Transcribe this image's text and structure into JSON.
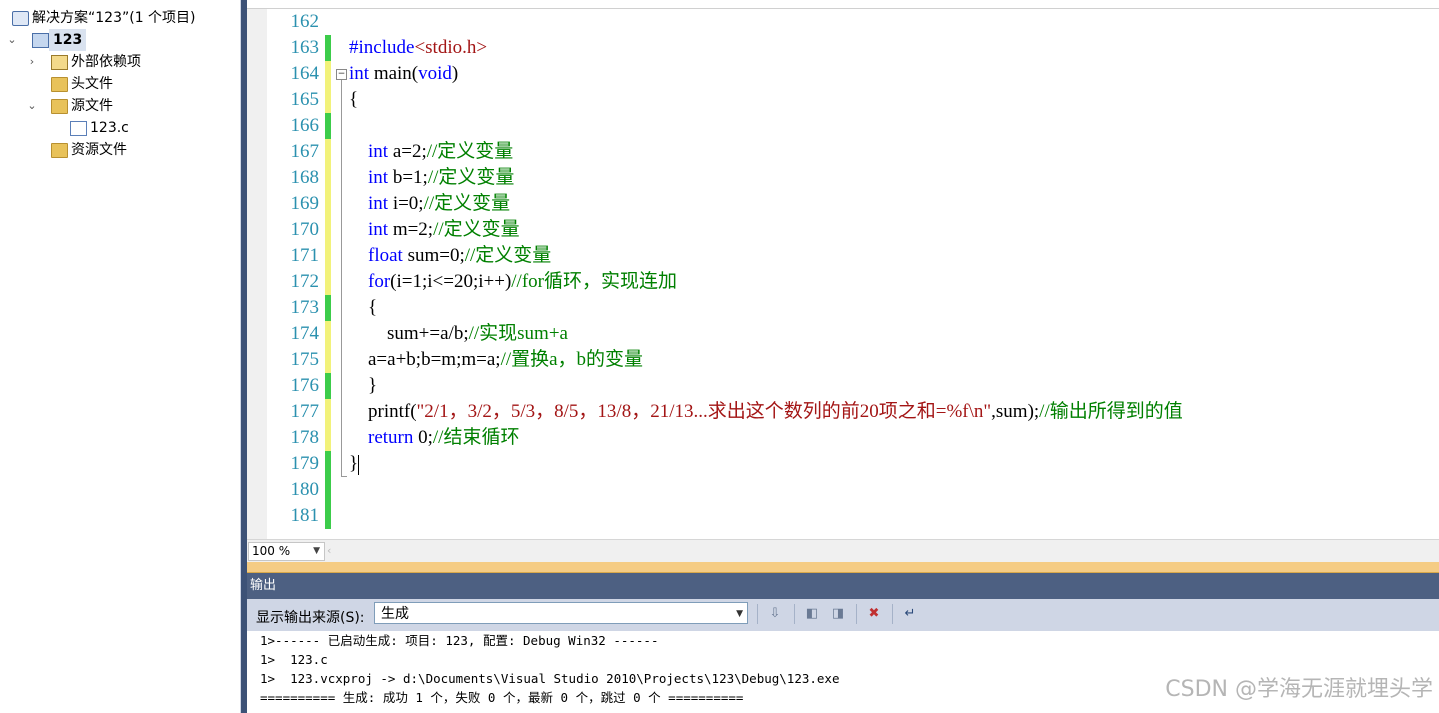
{
  "solution_explorer": {
    "solution_label": "解决方案“123”(1 个项目)",
    "project_label": "123",
    "items": [
      {
        "label": "外部依赖项",
        "icon": "external-deps-icon"
      },
      {
        "label": "头文件",
        "icon": "folder-icon"
      },
      {
        "label": "源文件",
        "icon": "folder-open-icon"
      },
      {
        "label": "123.c",
        "icon": "c-file-icon"
      },
      {
        "label": "资源文件",
        "icon": "folder-icon"
      }
    ]
  },
  "editor": {
    "line_numbers": [
      "162",
      "163",
      "164",
      "165",
      "166",
      "167",
      "168",
      "169",
      "170",
      "171",
      "172",
      "173",
      "174",
      "175",
      "176",
      "177",
      "178",
      "179",
      "180",
      "181"
    ],
    "lines": [
      {
        "segments": []
      },
      {
        "segments": [
          {
            "t": "#include",
            "c": "kw"
          },
          {
            "t": "<stdio.h>",
            "c": "st"
          }
        ]
      },
      {
        "segments": [
          {
            "t": "int",
            "c": "kw"
          },
          {
            "t": " main(",
            "c": ""
          },
          {
            "t": "void",
            "c": "kw"
          },
          {
            "t": ")",
            "c": ""
          }
        ]
      },
      {
        "segments": [
          {
            "t": "{",
            "c": ""
          }
        ]
      },
      {
        "segments": []
      },
      {
        "segments": [
          {
            "t": "    ",
            "c": ""
          },
          {
            "t": "int",
            "c": "kw"
          },
          {
            "t": " a=2;",
            "c": ""
          },
          {
            "t": "//定义变量",
            "c": "cm"
          }
        ]
      },
      {
        "segments": [
          {
            "t": "    ",
            "c": ""
          },
          {
            "t": "int",
            "c": "kw"
          },
          {
            "t": " b=1;",
            "c": ""
          },
          {
            "t": "//定义变量",
            "c": "cm"
          }
        ]
      },
      {
        "segments": [
          {
            "t": "    ",
            "c": ""
          },
          {
            "t": "int",
            "c": "kw"
          },
          {
            "t": " i=0;",
            "c": ""
          },
          {
            "t": "//定义变量",
            "c": "cm"
          }
        ]
      },
      {
        "segments": [
          {
            "t": "    ",
            "c": ""
          },
          {
            "t": "int",
            "c": "kw"
          },
          {
            "t": " m=2;",
            "c": ""
          },
          {
            "t": "//定义变量",
            "c": "cm"
          }
        ]
      },
      {
        "segments": [
          {
            "t": "    ",
            "c": ""
          },
          {
            "t": "float",
            "c": "kw"
          },
          {
            "t": " sum=0;",
            "c": ""
          },
          {
            "t": "//定义变量",
            "c": "cm"
          }
        ]
      },
      {
        "segments": [
          {
            "t": "    ",
            "c": ""
          },
          {
            "t": "for",
            "c": "kw"
          },
          {
            "t": "(i=1;i<=20;i++)",
            "c": ""
          },
          {
            "t": "//for循环，实现连加",
            "c": "cm"
          }
        ]
      },
      {
        "segments": [
          {
            "t": "    {",
            "c": ""
          }
        ]
      },
      {
        "segments": [
          {
            "t": "        sum+=a/b;",
            "c": ""
          },
          {
            "t": "//实现sum+a",
            "c": "cm"
          }
        ]
      },
      {
        "segments": [
          {
            "t": "    a=a+b;b=m;m=a;",
            "c": ""
          },
          {
            "t": "//置换a，b的变量",
            "c": "cm"
          }
        ]
      },
      {
        "segments": [
          {
            "t": "    }",
            "c": ""
          }
        ]
      },
      {
        "segments": [
          {
            "t": "    printf(",
            "c": ""
          },
          {
            "t": "\"2/1，3/2，5/3，8/5，13/8，21/13...求出这个数列的前20项之和=%f\\n\"",
            "c": "st"
          },
          {
            "t": ",sum);",
            "c": ""
          },
          {
            "t": "//输出所得到的值",
            "c": "cm"
          }
        ]
      },
      {
        "segments": [
          {
            "t": "    ",
            "c": ""
          },
          {
            "t": "return",
            "c": "kw"
          },
          {
            "t": " 0;",
            "c": ""
          },
          {
            "t": "//结束循环",
            "c": "cm"
          }
        ]
      },
      {
        "segments": [
          {
            "t": "}",
            "c": ""
          }
        ]
      },
      {
        "segments": []
      },
      {
        "segments": []
      }
    ],
    "change_markers": [
      "none",
      "green",
      "yellow",
      "yellow",
      "green",
      "yellow",
      "yellow",
      "yellow",
      "yellow",
      "yellow",
      "yellow",
      "green",
      "yellow",
      "yellow",
      "green",
      "yellow",
      "yellow",
      "green",
      "green",
      "green"
    ],
    "zoom": "100 %"
  },
  "output": {
    "title": "输出",
    "source_label": "显示输出来源(S):",
    "source_value": "生成",
    "lines": [
      "1>------ 已启动生成: 项目: 123, 配置: Debug Win32 ------",
      "1>  123.c",
      "1>  123.vcxproj -> d:\\Documents\\Visual Studio 2010\\Projects\\123\\Debug\\123.exe",
      "========== 生成: 成功 1 个，失败 0 个，最新 0 个，跳过 0 个 =========="
    ]
  },
  "watermark": "CSDN @学海无涯就埋头学",
  "colors": {
    "change_green": "#3ccc4a",
    "change_yellow": "#f2f27a"
  }
}
